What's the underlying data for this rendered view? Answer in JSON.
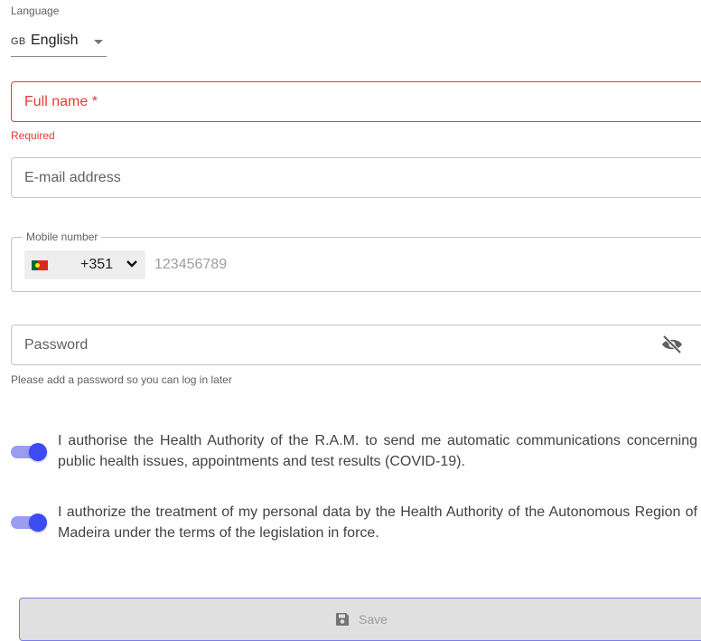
{
  "language": {
    "label": "Language",
    "code": "GB",
    "value": "English"
  },
  "full_name": {
    "label": "Full name *",
    "error": "Required"
  },
  "email": {
    "label": "E-mail address"
  },
  "mobile": {
    "label": "Mobile number",
    "flag": "portugal-flag",
    "dial_code": "+351",
    "placeholder": "123456789"
  },
  "password": {
    "label": "Password",
    "helper": "Please add a password so you can log in later",
    "icon": "eye-off-icon"
  },
  "consents": [
    {
      "text": "I authorise the Health Authority of the R.A.M. to send me automatic communications concerning public health issues, appointments and test results (COVID-19).",
      "checked": true
    },
    {
      "text": "I authorize the treatment of my personal data by the Health Authority of the Autonomous Region of Madeira under the terms of the legislation in force.",
      "checked": true
    }
  ],
  "save": {
    "label": "Save",
    "icon": "save-icon"
  },
  "colors": {
    "error": "#e53935",
    "toggle_thumb": "#3d4bf5",
    "toggle_track": "#9a9cf0",
    "save_border": "#7b7bf0"
  }
}
